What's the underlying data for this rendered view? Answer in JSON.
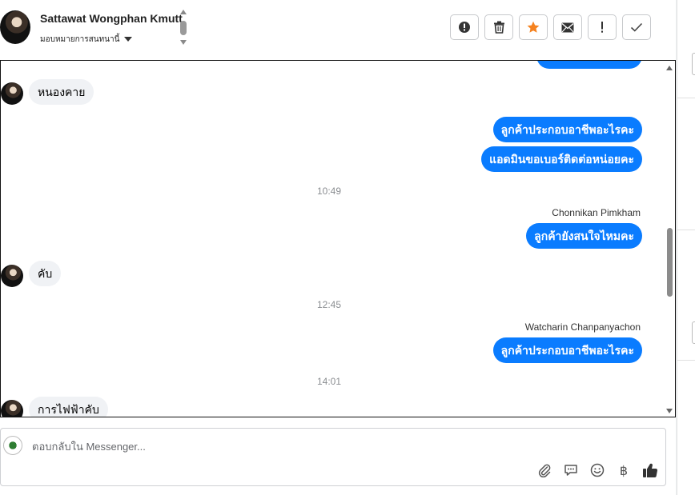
{
  "header": {
    "contact_name": "Sattawat Wongphan Kmutt",
    "assign_label": "มอบหมายการสนทนานี้",
    "actions": [
      {
        "icon": "alert-circle-icon",
        "name": "mark-spam-button"
      },
      {
        "icon": "trash-icon",
        "name": "delete-button"
      },
      {
        "icon": "star-icon",
        "name": "star-button"
      },
      {
        "icon": "envelope-icon",
        "name": "mark-unread-button"
      },
      {
        "icon": "exclamation-icon",
        "name": "follow-up-button"
      },
      {
        "icon": "check-icon",
        "name": "mark-done-button"
      }
    ],
    "accent_star_color": "#f5821f"
  },
  "conversation": {
    "messages": [
      {
        "type": "in",
        "text": "หนองคาย"
      },
      {
        "type": "out",
        "text": "ลูกค้าประกอบอาชีพอะไรคะ"
      },
      {
        "type": "out",
        "text": "แอดมินขอเบอร์ติดต่อหน่อยคะ"
      },
      {
        "type": "timestamp",
        "text": "10:49"
      },
      {
        "type": "sender",
        "text": "Chonnikan Pimkham"
      },
      {
        "type": "out",
        "text": "ลูกค้ายังสนใจไหมคะ"
      },
      {
        "type": "in",
        "text": "คับ"
      },
      {
        "type": "timestamp",
        "text": "12:45"
      },
      {
        "type": "sender",
        "text": "Watcharin Chanpanyachon"
      },
      {
        "type": "out",
        "text": "ลูกค้าประกอบอาชีพอะไรคะ"
      },
      {
        "type": "timestamp",
        "text": "14:01"
      },
      {
        "type": "in",
        "text": "การไฟฟ้าคับ"
      }
    ],
    "outgoing_color": "#0a7cff",
    "incoming_color": "#f0f2f5"
  },
  "composer": {
    "placeholder": "ตอบกลับใน Messenger...",
    "tools": [
      {
        "icon": "paperclip-icon"
      },
      {
        "icon": "saved-reply-icon"
      },
      {
        "icon": "emoji-icon"
      },
      {
        "icon": "baht-icon",
        "glyph": "฿"
      },
      {
        "icon": "thumbs-up-icon"
      }
    ]
  }
}
